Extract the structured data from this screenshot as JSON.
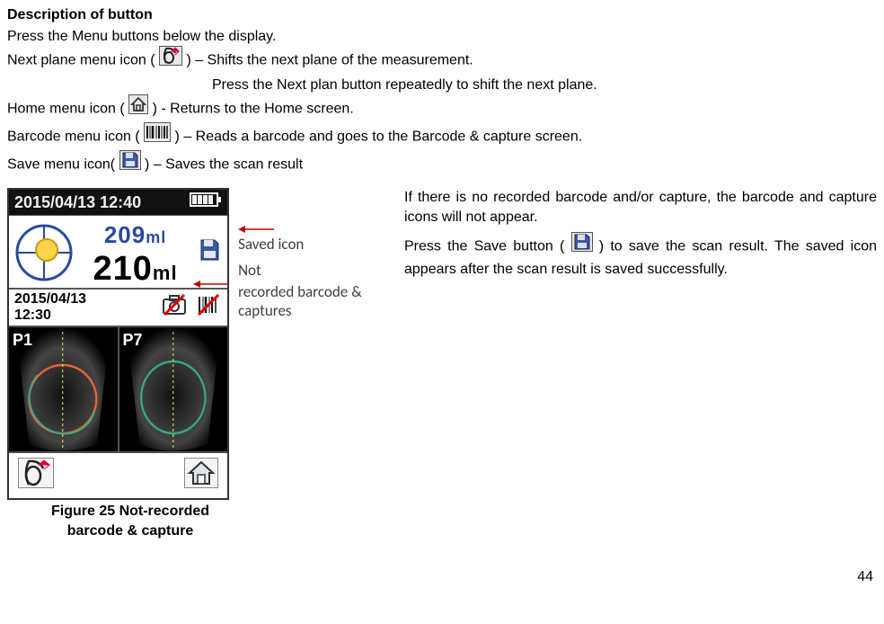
{
  "header": {
    "title": "Description of button"
  },
  "intro": {
    "line1": "Press the Menu buttons below the display."
  },
  "desc": {
    "next1a": "Next plane menu icon (",
    "next1b": ") – Shifts the next plane of the measurement.",
    "next2": "Press the Next plan button repeatedly to shift the next plane.",
    "home_a": "Home menu icon (",
    "home_b": ") - Returns to the Home screen.",
    "barcode_a": "Barcode menu icon (",
    "barcode_b": ") – Reads a barcode and goes to the Barcode & capture screen.",
    "save_a": "Save menu icon(",
    "save_b": ") – Saves the scan result"
  },
  "device": {
    "clock": "2015/04/13 12:40",
    "reading_top": "209",
    "reading_top_unit": "ml",
    "reading_main": "210",
    "reading_main_unit": "ml",
    "saved_date": "2015/04/13",
    "saved_time": "12:30",
    "pane1": "P1",
    "pane7": "P7"
  },
  "annotations": {
    "saved": "Saved icon",
    "notrec": "Not recorded barcode & captures"
  },
  "figure": {
    "caption_l1": "Figure 25 Not-recorded",
    "caption_l2": "barcode & capture"
  },
  "right": {
    "p1": "If there is no recorded barcode and/or capture, the barcode and capture icons will not appear.",
    "p2a": "Press the Save button ( ",
    "p2b": " ) to save the scan result. The saved icon appears after the scan result is saved successfully."
  },
  "page": {
    "num": "44"
  }
}
